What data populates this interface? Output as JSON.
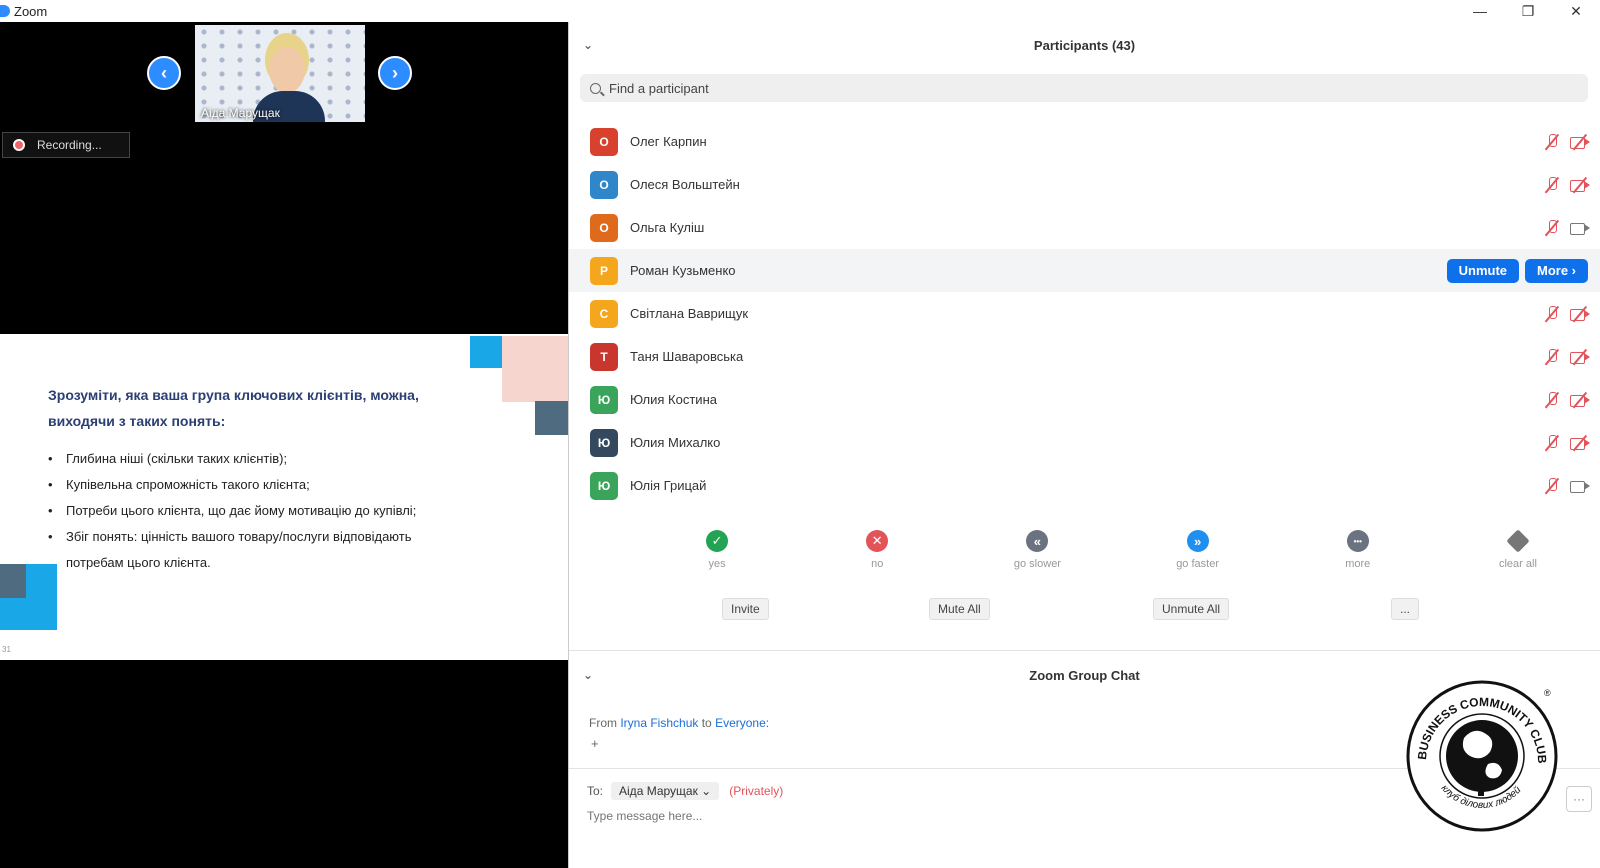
{
  "window": {
    "title": "Zoom",
    "controls": [
      "—",
      "❐",
      "✕"
    ]
  },
  "video": {
    "speaker_name": "Аіда Марущак",
    "recording_label": "Recording...",
    "prev_arrow": "‹",
    "next_arrow": "›"
  },
  "slide": {
    "heading": "Зрозуміти, яка ваша група ключових клієнтів, можна, виходячи з таких понять:",
    "bullets": [
      "Глибина ніші (скільки таких клієнтів);",
      "Купівельна спроможність такого клієнта;",
      "Потреби цього клієнта, що дає йому мотивацію до купівлі;",
      "Збіг понять: цінність вашого товару/послуги відповідають потребам цього клієнта."
    ],
    "page": "31"
  },
  "participants": {
    "title": "Participants (43)",
    "collapse_icon": "⌄",
    "search_placeholder": "Find a participant",
    "list": [
      {
        "initial": "О",
        "name": "Олег Карпин",
        "color": "#d9412f",
        "video": "off"
      },
      {
        "initial": "О",
        "name": "Олеся Вольштейн",
        "color": "#2f86c9",
        "video": "off"
      },
      {
        "initial": "О",
        "name": "Ольга Куліш",
        "color": "#e06a1c",
        "video": "on"
      },
      {
        "initial": "Р",
        "name": "Роман Кузьменко",
        "color": "#f4a61d",
        "video": "hover"
      },
      {
        "initial": "С",
        "name": "Світлана Ваврищук",
        "color": "#f4a61d",
        "video": "off"
      },
      {
        "initial": "Т",
        "name": "Таня Шаваровська",
        "color": "#c9362e",
        "video": "off"
      },
      {
        "initial": "Ю",
        "name": "Юлия Костина",
        "color": "#3aa55a",
        "video": "off"
      },
      {
        "initial": "Ю",
        "name": "Юлия Михалко",
        "color": "#34495e",
        "video": "off"
      },
      {
        "initial": "Ю",
        "name": "Юлія Грицай",
        "color": "#3aa55a",
        "video": "on"
      }
    ],
    "unmute_label": "Unmute",
    "more_label": "More ›",
    "reactions": [
      {
        "label": "yes",
        "glyph": "✓",
        "color": "#23a455"
      },
      {
        "label": "no",
        "glyph": "✕",
        "color": "#e2535a"
      },
      {
        "label": "go slower",
        "glyph": "«",
        "color": "#6b7280"
      },
      {
        "label": "go faster",
        "glyph": "»",
        "color": "#1f8ff0"
      },
      {
        "label": "more",
        "glyph": "•••",
        "color": "#6b7280"
      },
      {
        "label": "clear all",
        "glyph": "",
        "color": "#777777"
      }
    ],
    "actions": {
      "invite": "Invite",
      "mute_all": "Mute All",
      "unmute_all": "Unmute All",
      "more": "..."
    }
  },
  "chat": {
    "title": "Zoom Group Chat",
    "from_prefix": "From",
    "from_name": "Iryna Fishchuk",
    "to_word": "to",
    "to_name": "Everyone:",
    "message": "+",
    "to_label": "To:",
    "recipient": "Аіда Марущак ⌄",
    "privately": "(Privately)",
    "input_placeholder": "Type message here...",
    "more": "···"
  },
  "logo": {
    "text_top": "BUSINESS COMMUNITY CLUB",
    "text_bottom": "клуб ділових людей",
    "mark": "®"
  }
}
